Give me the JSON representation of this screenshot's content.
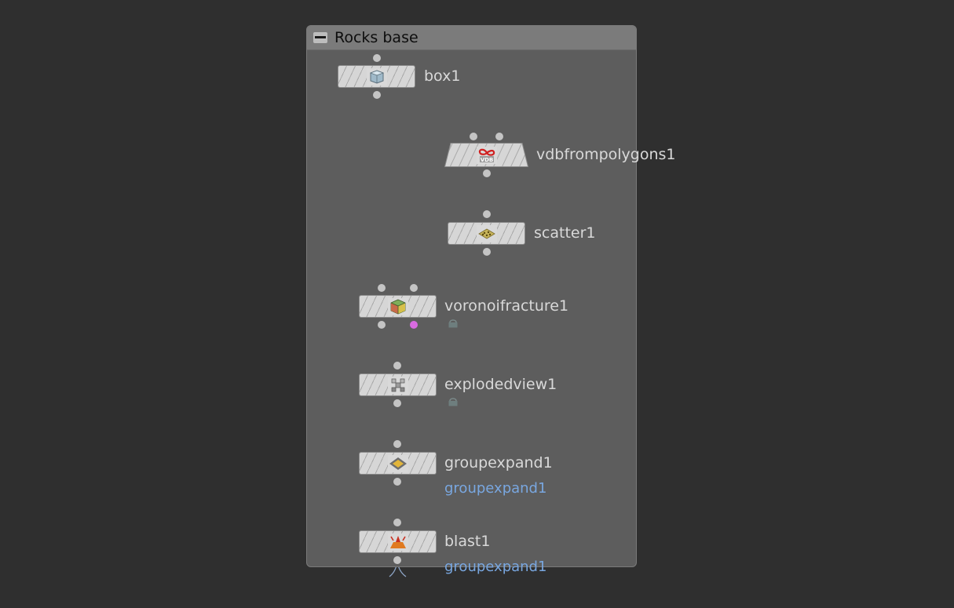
{
  "network_box": {
    "title": "Rocks base"
  },
  "nodes": {
    "box1": {
      "label": "box1",
      "icon": "box-icon"
    },
    "vdbfrompolygons1": {
      "label": "vdbfrompolygons1",
      "icon": "vdb-icon",
      "icon_text": "VDB"
    },
    "scatter1": {
      "label": "scatter1",
      "icon": "scatter-icon"
    },
    "voronoifracture1": {
      "label": "voronoifracture1",
      "icon": "voronoi-icon"
    },
    "explodedview1": {
      "label": "explodedview1",
      "icon": "exploded-view-icon"
    },
    "groupexpand1": {
      "label": "groupexpand1",
      "icon": "group-expand-icon",
      "group_badge": "groupexpand1"
    },
    "blast1": {
      "label": "blast1",
      "icon": "blast-icon",
      "group_badge": "groupexpand1"
    }
  },
  "colors": {
    "background": "#2f2f2f",
    "box_fill": "#5d5d5d",
    "header_fill": "#7b7b7b",
    "wire": "#8fa7c9",
    "label": "#d9d9d9",
    "group_badge": "#79a7e0",
    "output_flag_pink": "#d86be0"
  }
}
